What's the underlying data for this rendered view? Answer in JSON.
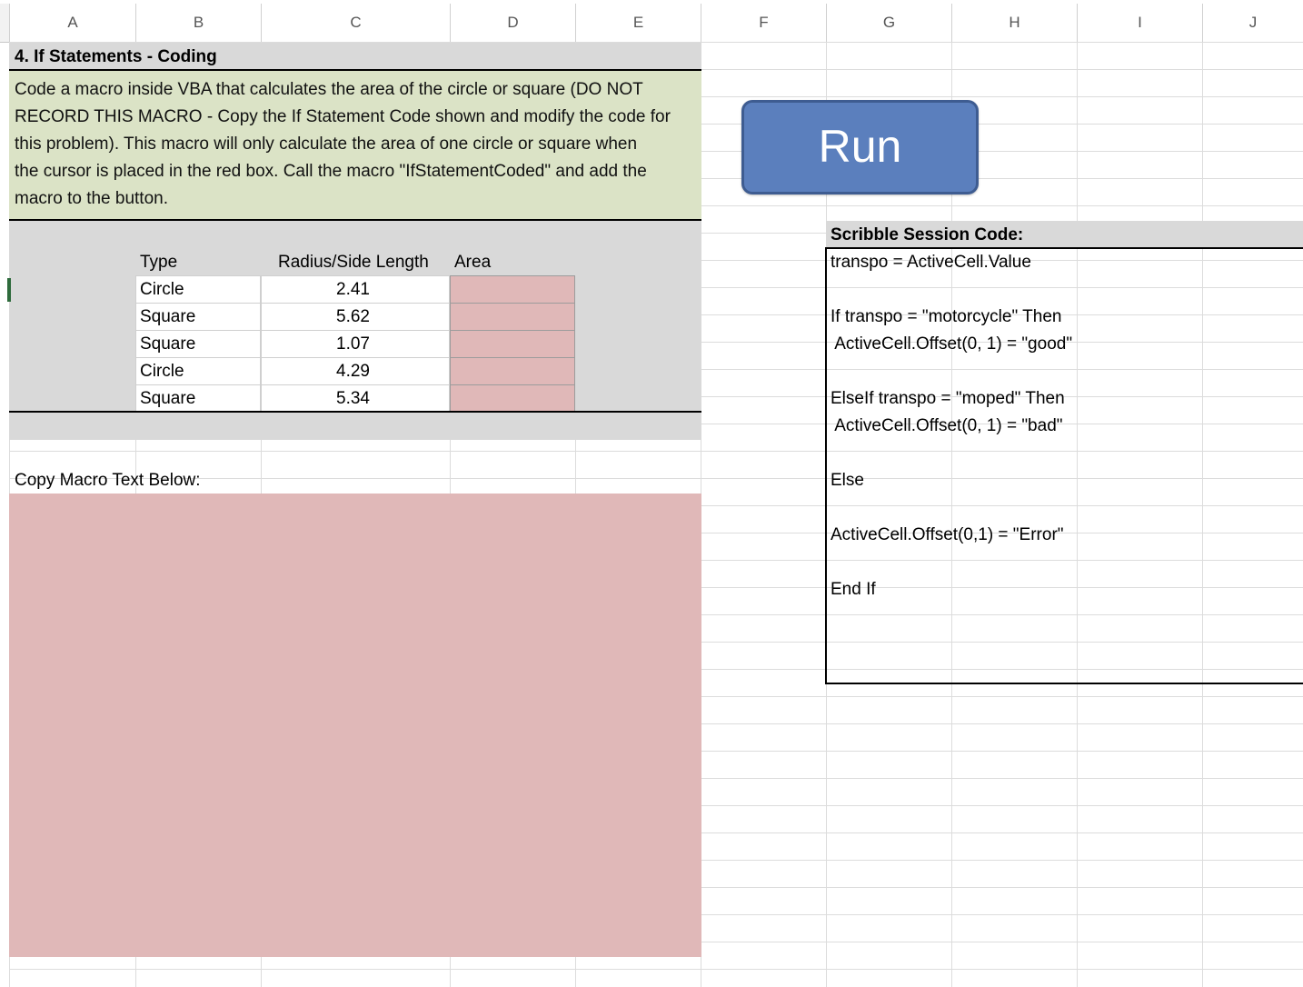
{
  "columns": [
    "A",
    "B",
    "C",
    "D",
    "E",
    "F",
    "G",
    "H",
    "I",
    "J"
  ],
  "section_title": "4. If Statements - Coding",
  "description_lines": [
    "Code a macro inside VBA that calculates the area of the circle or square (DO NOT",
    "RECORD THIS MACRO - Copy the If Statement Code shown and modify the code for",
    "this problem).  This macro will only calculate the area of one circle or square when",
    "the cursor is placed in the red box.  Call the macro \"IfStatementCoded\" and add the",
    "macro to the button."
  ],
  "table": {
    "headers": {
      "type": "Type",
      "radius": "Radius/Side Length",
      "area": "Area"
    },
    "rows": [
      {
        "type": "Circle",
        "value": "2.41",
        "area": ""
      },
      {
        "type": "Square",
        "value": "5.62",
        "area": ""
      },
      {
        "type": "Square",
        "value": "1.07",
        "area": ""
      },
      {
        "type": "Circle",
        "value": "4.29",
        "area": ""
      },
      {
        "type": "Square",
        "value": "5.34",
        "area": ""
      }
    ]
  },
  "copy_label": "Copy Macro Text Below:",
  "run_button": {
    "label": "Run",
    "color": "#5b7fbd"
  },
  "scribble": {
    "title": "Scribble Session Code:",
    "lines": [
      "transpo = ActiveCell.Value",
      "",
      "If transpo = \"motorcycle\" Then",
      " ActiveCell.Offset(0, 1) = \"good\"",
      "",
      "ElseIf transpo = \"moped\" Then",
      " ActiveCell.Offset(0, 1) = \"bad\"",
      "",
      "Else",
      "",
      "ActiveCell.Offset(0,1) = \"Error\"",
      "",
      "End If"
    ]
  },
  "colors": {
    "gray_fill": "#d9d9d9",
    "green_fill": "#dbe3c6",
    "pink_fill": "#e0b8b8"
  }
}
